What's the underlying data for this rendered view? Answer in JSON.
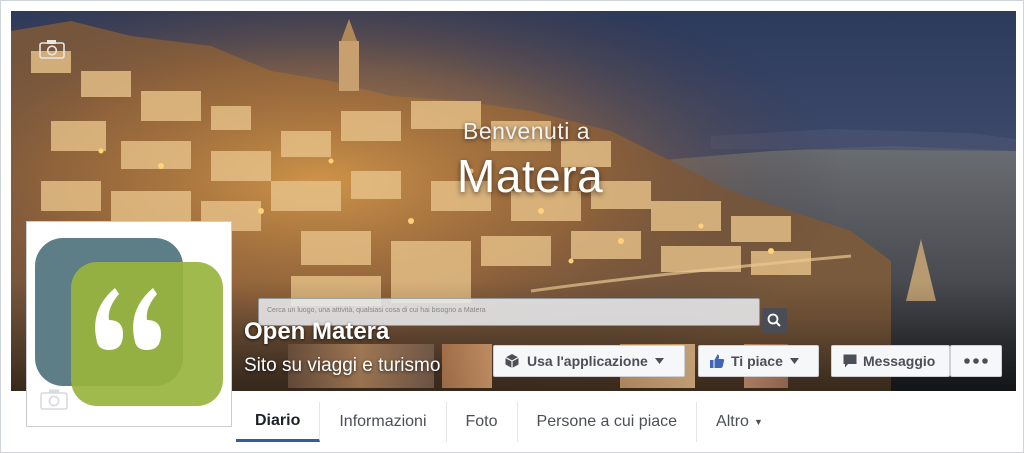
{
  "cover": {
    "welcome_line1": "Benvenuti a",
    "welcome_line2": "Matera"
  },
  "search": {
    "placeholder": "Cerca un luogo, una attività, qualsiasi cosa di cui hai bisogno a Matera"
  },
  "page": {
    "name": "Open Matera",
    "subtitle": "Sito su viaggi e turismo"
  },
  "actions": {
    "use_app": "Usa l'applicazione",
    "like": "Ti piace",
    "message": "Messaggio"
  },
  "tabs": [
    {
      "label": "Diario",
      "active": true
    },
    {
      "label": "Informazioni",
      "active": false
    },
    {
      "label": "Foto",
      "active": false
    },
    {
      "label": "Persone a cui piace",
      "active": false
    },
    {
      "label": "Altro",
      "active": false
    }
  ],
  "colors": {
    "logo_dark": "#5d7e86",
    "logo_light": "#99b43e",
    "tab_underline": "#3b5998",
    "like_icon": "#4267b2"
  },
  "icons": [
    "camera-icon",
    "search-icon",
    "cube-icon",
    "thumbs-up-icon",
    "speech-bubble-icon",
    "more-dots-icon",
    "caret-down-icon",
    "quote-icon"
  ]
}
